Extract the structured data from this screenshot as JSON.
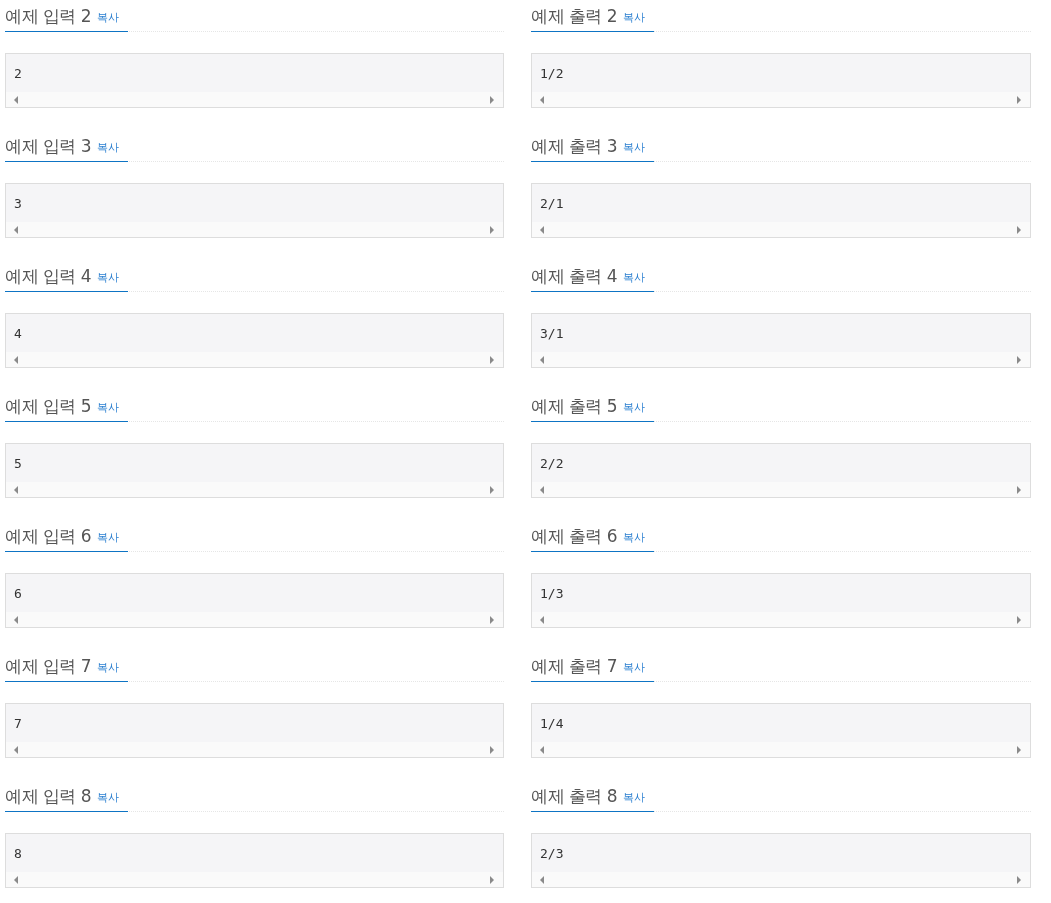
{
  "samples": [
    {
      "input": {
        "title": "예제 입력 2",
        "copy": "복사",
        "value": "2"
      },
      "output": {
        "title": "예제 출력 2",
        "copy": "복사",
        "value": "1/2"
      }
    },
    {
      "input": {
        "title": "예제 입력 3",
        "copy": "복사",
        "value": "3"
      },
      "output": {
        "title": "예제 출력 3",
        "copy": "복사",
        "value": "2/1"
      }
    },
    {
      "input": {
        "title": "예제 입력 4",
        "copy": "복사",
        "value": "4"
      },
      "output": {
        "title": "예제 출력 4",
        "copy": "복사",
        "value": "3/1"
      }
    },
    {
      "input": {
        "title": "예제 입력 5",
        "copy": "복사",
        "value": "5"
      },
      "output": {
        "title": "예제 출력 5",
        "copy": "복사",
        "value": "2/2"
      }
    },
    {
      "input": {
        "title": "예제 입력 6",
        "copy": "복사",
        "value": "6"
      },
      "output": {
        "title": "예제 출력 6",
        "copy": "복사",
        "value": "1/3"
      }
    },
    {
      "input": {
        "title": "예제 입력 7",
        "copy": "복사",
        "value": "7"
      },
      "output": {
        "title": "예제 출력 7",
        "copy": "복사",
        "value": "1/4"
      }
    },
    {
      "input": {
        "title": "예제 입력 8",
        "copy": "복사",
        "value": "8"
      },
      "output": {
        "title": "예제 출력 8",
        "copy": "복사",
        "value": "2/3"
      }
    }
  ]
}
